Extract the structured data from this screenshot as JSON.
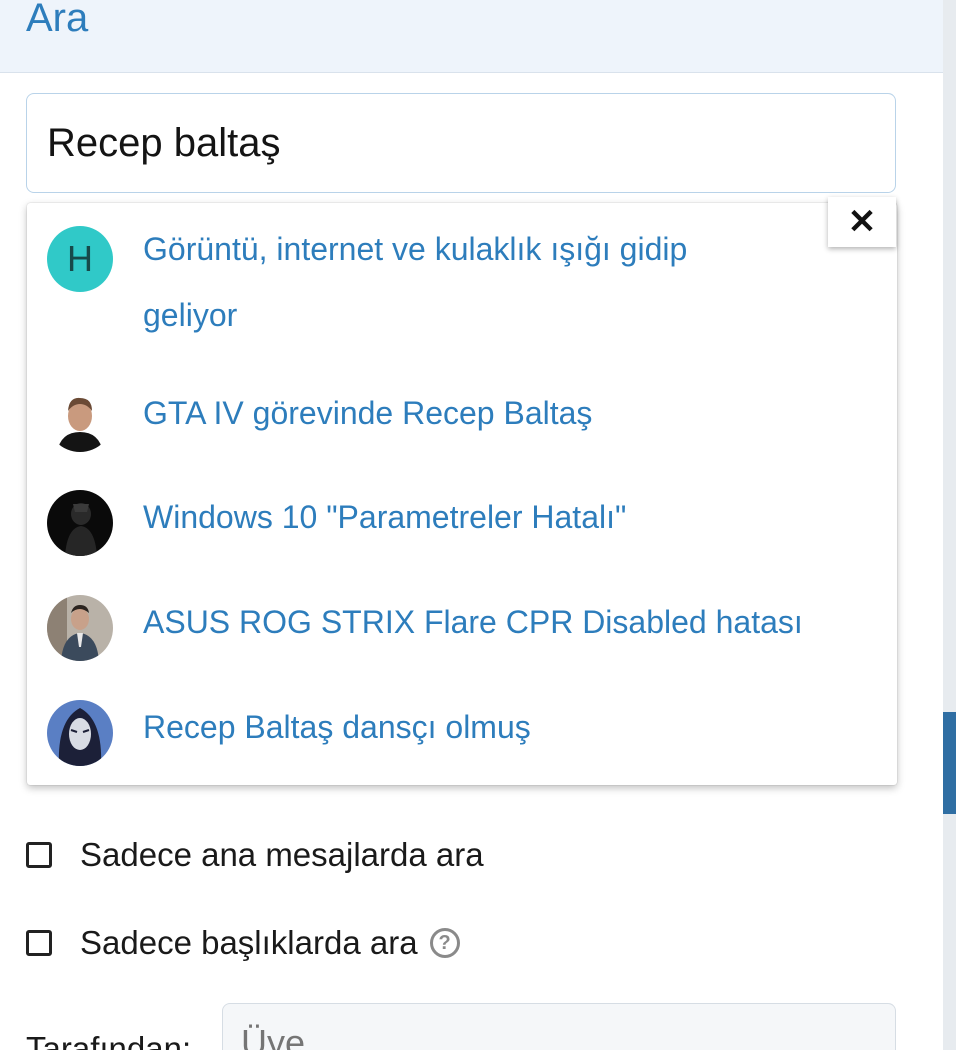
{
  "header": {
    "title": "Ara"
  },
  "search": {
    "value": "Recep baltaş"
  },
  "dropdown": {
    "close_symbol": "✕",
    "results": [
      {
        "title": "Görüntü, internet ve kulaklık ışığı gidip",
        "title_line2": "geliyor",
        "avatar_letter": "H",
        "avatar_color": "#30c9c8"
      },
      {
        "title": "GTA IV görevinde Recep Baltaş",
        "avatar_icon": "user-photo-icon"
      },
      {
        "title": "Windows 10 \"Parametreler Hatalı\"",
        "avatar_icon": "user-photo-icon"
      },
      {
        "title": "ASUS ROG STRIX Flare CPR Disabled hatası",
        "avatar_icon": "user-photo-icon"
      },
      {
        "title": "Recep Baltaş dansçı olmuş",
        "avatar_icon": "user-photo-icon"
      }
    ]
  },
  "options": {
    "only_main_messages": "Sadece ana mesajlarda ara",
    "only_titles": "Sadece başlıklarda ara",
    "help_symbol": "?"
  },
  "by": {
    "label": "Tarafından:",
    "placeholder": "Üye"
  },
  "colors": {
    "accent": "#2d7dbc",
    "link": "#2d7dbc"
  }
}
